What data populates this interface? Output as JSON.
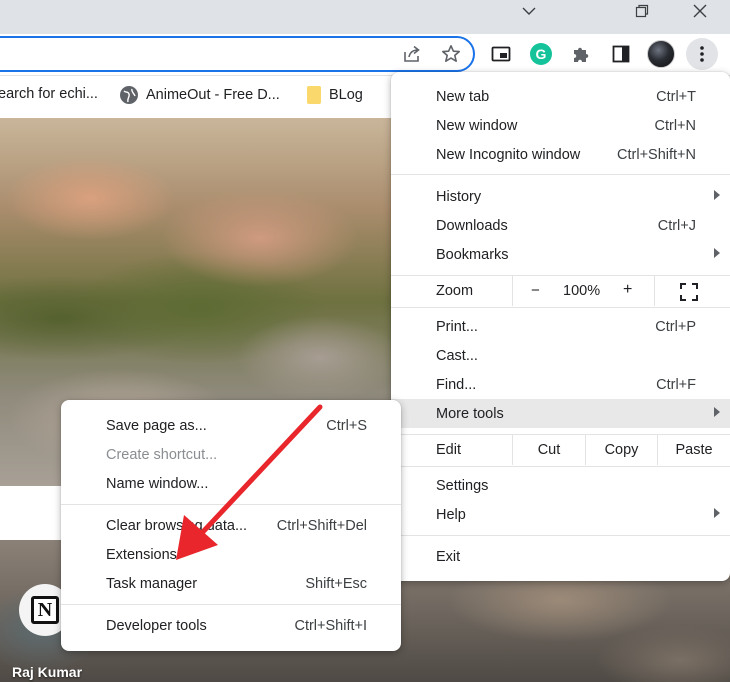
{
  "window": {
    "controls": [
      "chevron-down-icon",
      "restore-icon",
      "close-icon"
    ]
  },
  "toolbar": {
    "icons": [
      "share-icon",
      "star-icon",
      "picture-in-picture-icon",
      "grammarly-icon",
      "puzzle-extensions-icon",
      "side-panel-icon",
      "avatar",
      "more-vert-icon"
    ],
    "grammarly_letter": "G"
  },
  "bookmarks": [
    {
      "label": "earch for echi..."
    },
    {
      "label": "AnimeOut - Free D..."
    },
    {
      "label": "BLog"
    }
  ],
  "menu": {
    "items": [
      {
        "label": "New tab",
        "shortcut": "Ctrl+T"
      },
      {
        "label": "New window",
        "shortcut": "Ctrl+N"
      },
      {
        "label": "New Incognito window",
        "shortcut": "Ctrl+Shift+N"
      },
      {
        "label": "History",
        "shortcut": ""
      },
      {
        "label": "Downloads",
        "shortcut": "Ctrl+J"
      },
      {
        "label": "Bookmarks",
        "shortcut": ""
      },
      {
        "label": "Print...",
        "shortcut": "Ctrl+P"
      },
      {
        "label": "Cast...",
        "shortcut": ""
      },
      {
        "label": "Find...",
        "shortcut": "Ctrl+F"
      },
      {
        "label": "More tools",
        "shortcut": ""
      },
      {
        "label": "Settings",
        "shortcut": ""
      },
      {
        "label": "Help",
        "shortcut": ""
      },
      {
        "label": "Exit",
        "shortcut": ""
      }
    ],
    "zoom": {
      "label": "Zoom",
      "minus": "−",
      "value": "100%",
      "plus": "+"
    },
    "edit": {
      "label": "Edit",
      "cut": "Cut",
      "copy": "Copy",
      "paste": "Paste"
    }
  },
  "submenu": {
    "items": [
      {
        "label": "Save page as...",
        "shortcut": "Ctrl+S"
      },
      {
        "label": "Create shortcut...",
        "shortcut": ""
      },
      {
        "label": "Name window...",
        "shortcut": ""
      },
      {
        "label": "Clear browsing data...",
        "shortcut": "Ctrl+Shift+Del"
      },
      {
        "label": "Extensions",
        "shortcut": ""
      },
      {
        "label": "Task manager",
        "shortcut": "Shift+Esc"
      },
      {
        "label": "Developer tools",
        "shortcut": "Ctrl+Shift+I"
      }
    ]
  },
  "page": {
    "notion_letter": "N",
    "photo_credit": "Raj Kumar"
  },
  "colors": {
    "omnibox_focus": "#1a73e8",
    "annotation_arrow": "#e8262b",
    "grammarly": "#15c39a",
    "menu_highlight": "#e8e8e9"
  }
}
